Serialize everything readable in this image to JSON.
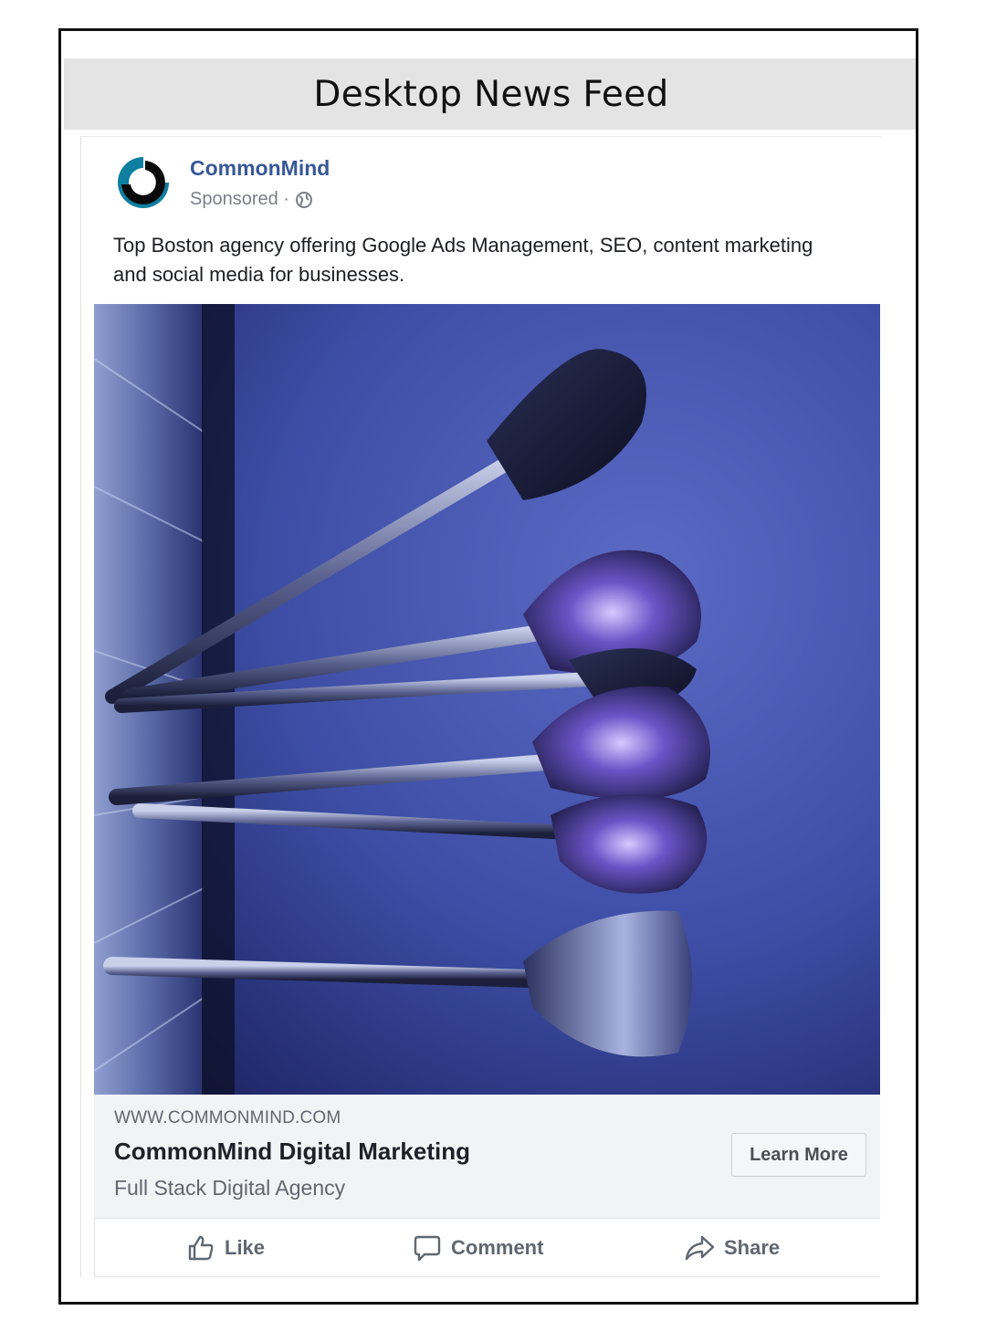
{
  "banner": {
    "title": "Desktop News Feed"
  },
  "post": {
    "page_name": "CommonMind",
    "sponsored_label": "Sponsored ·",
    "body_text": "Top Boston agency offering Google Ads Management, SEO, content marketing and social media for businesses.",
    "link": {
      "domain": "WWW.COMMONMIND.COM",
      "headline": "CommonMind Digital Marketing",
      "description": "Full Stack Digital Agency",
      "cta_label": "Learn More"
    },
    "actions": {
      "like_label": "Like",
      "comment_label": "Comment",
      "share_label": "Share"
    }
  },
  "icons": {
    "globe": "globe-icon",
    "like": "thumbs-up-icon",
    "comment": "speech-bubble-icon",
    "share": "share-arrow-icon"
  },
  "colors": {
    "page_name": "#385898",
    "photo_background": "#3f4fa8",
    "cta_background": "#f5f6f7"
  }
}
